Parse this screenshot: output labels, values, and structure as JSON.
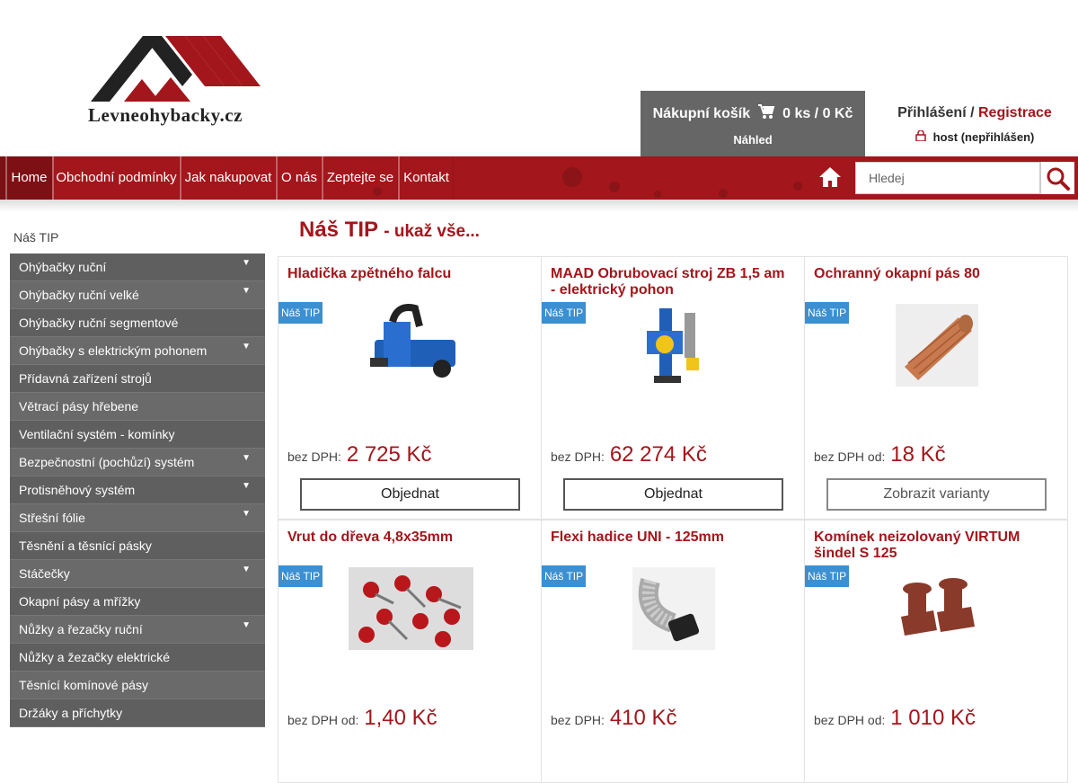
{
  "header": {
    "logo_text": "Levneohybacky.cz",
    "cart": {
      "label": "Nákupní košík",
      "summary": "0 ks / 0 Kč",
      "preview": "Náhled"
    },
    "login": {
      "login_label": "Přihlášení",
      "separator": " / ",
      "register_label": "Registrace",
      "user_status": "host (nepřihlášen)"
    }
  },
  "nav": {
    "items": [
      "Home",
      "Obchodní podmínky",
      "Jak nakupovat",
      "O nás",
      "Zeptejte se",
      "Kontakt"
    ],
    "search_placeholder": "Hledej"
  },
  "sidebar": {
    "title": "Náš TIP",
    "items": [
      {
        "label": "Ohýbačky ruční",
        "has_submenu": true
      },
      {
        "label": "Ohýbačky ruční velké",
        "has_submenu": true
      },
      {
        "label": "Ohýbačky ruční segmentové",
        "has_submenu": false
      },
      {
        "label": "Ohýbačky s elektrickým pohonem",
        "has_submenu": true
      },
      {
        "label": "Přídavná zařízení strojů",
        "has_submenu": false
      },
      {
        "label": "Větrací pásy hřebene",
        "has_submenu": false
      },
      {
        "label": "Ventilační systém - komínky",
        "has_submenu": false
      },
      {
        "label": "Bezpečnostní (pochůzí) systém",
        "has_submenu": true
      },
      {
        "label": "Protisněhový systém",
        "has_submenu": true
      },
      {
        "label": "Střešní fólie",
        "has_submenu": true
      },
      {
        "label": "Těsnění a těsnící pásky",
        "has_submenu": false
      },
      {
        "label": "Stáčečky",
        "has_submenu": true
      },
      {
        "label": "Okapní pásy a mřížky",
        "has_submenu": false
      },
      {
        "label": "Nůžky a řezačky ruční",
        "has_submenu": true
      },
      {
        "label": "Nůžky a žezačky elektrické",
        "has_submenu": false
      },
      {
        "label": "Těsnící komínové pásy",
        "has_submenu": false
      },
      {
        "label": "Držáky a příchytky",
        "has_submenu": false
      }
    ],
    "arrow": "▼"
  },
  "main": {
    "title": "Náš TIP",
    "title_link": "- ukaž vše...",
    "products": [
      {
        "name": "Hladička zpětného falcu",
        "badge": "Náš TIP",
        "price_label": "bez DPH:",
        "price": "2 725 Kč",
        "button": "Objednat",
        "image": "bending-tool-blue",
        "button_type": "order"
      },
      {
        "name": "MAAD Obrubovací stroj ZB 1,5 am - elektrický pohon",
        "badge": "Náš TIP",
        "price_label": "bez DPH:",
        "price": "62 274 Kč",
        "button": "Objednat",
        "image": "flanging-machine",
        "button_type": "order"
      },
      {
        "name": "Ochranný okapní pás 80",
        "badge": "Náš TIP",
        "price_label": "bez DPH od:",
        "price": "18 Kč",
        "button": "Zobrazit varianty",
        "image": "copper-mesh-roll",
        "button_type": "variant"
      },
      {
        "name": "Vrut do dřeva 4,8x35mm",
        "badge": "Náš TIP",
        "price_label": "bez DPH od:",
        "price": "1,40 Kč",
        "image": "red-screws"
      },
      {
        "name": "Flexi hadice UNI - 125mm",
        "badge": "Náš TIP",
        "price_label": "bez DPH:",
        "price": "410 Kč",
        "image": "flexi-hose"
      },
      {
        "name": "Komínek neizolovaný VIRTUM šindel S 125",
        "badge": "Náš TIP",
        "price_label": "bez DPH od:",
        "price": "1 010 Kč",
        "image": "roof-vents"
      }
    ]
  }
}
